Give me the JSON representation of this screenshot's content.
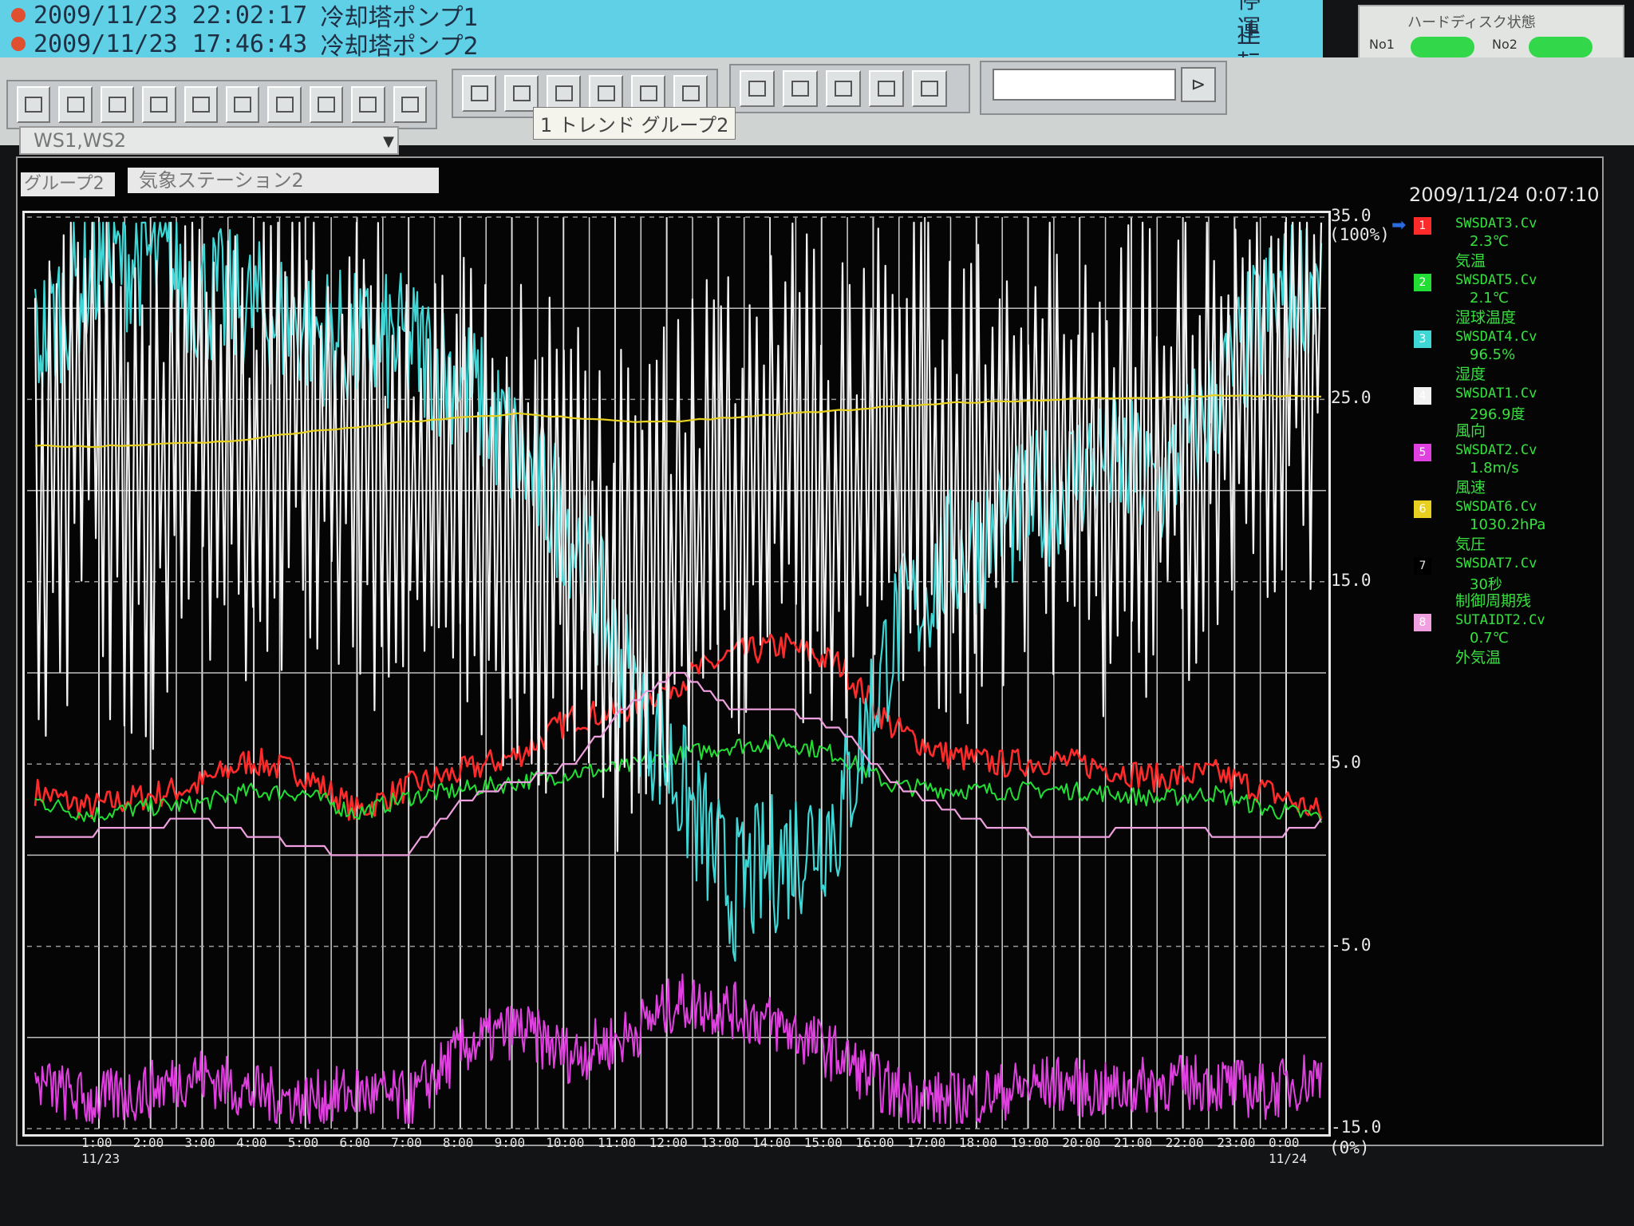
{
  "alarms": [
    {
      "time": "2009/11/23 22:02:17",
      "name": "冷却塔ポンプ1",
      "state": "停止"
    },
    {
      "time": "2009/11/23 17:46:43",
      "name": "冷却塔ポンプ2",
      "state": "運転"
    }
  ],
  "hdd": {
    "title": "ハードディスク状態",
    "no1": "No1",
    "no2": "No2"
  },
  "toolbar": {
    "tooltip": "1 トレンド グループ2",
    "ws_select": "WS1,WS2"
  },
  "group": {
    "label": "グループ2",
    "name": "気象ステーション2"
  },
  "timestamp": "2009/11/24 0:07:10",
  "legend": [
    {
      "no": "1",
      "tag": "SWSDAT3.Cv",
      "value": "2.3℃",
      "name": "気温",
      "color": "#ff2a2a"
    },
    {
      "no": "2",
      "tag": "SWSDAT5.Cv",
      "value": "2.1℃",
      "name": "湿球温度",
      "color": "#22dd33"
    },
    {
      "no": "3",
      "tag": "SWSDAT4.Cv",
      "value": "96.5%",
      "name": "湿度",
      "color": "#3fd6d6"
    },
    {
      "no": "4",
      "tag": "SWSDAT1.Cv",
      "value": "296.9度",
      "name": "風向",
      "color": "#f2f2f2"
    },
    {
      "no": "5",
      "tag": "SWSDAT2.Cv",
      "value": "1.8m/s",
      "name": "風速",
      "color": "#e040e0"
    },
    {
      "no": "6",
      "tag": "SWSDAT6.Cv",
      "value": "1030.2hPa",
      "name": "気圧",
      "color": "#e8d020"
    },
    {
      "no": "7",
      "tag": "SWSDAT7.Cv",
      "value": "30秒",
      "name": "制御周期残",
      "color": "#000000"
    },
    {
      "no": "8",
      "tag": "SUTAIDT2.Cv",
      "value": "0.7℃",
      "name": "外気温",
      "color": "#f0a0e0"
    }
  ],
  "chart_data": {
    "type": "line",
    "x": [
      "1:00",
      "2:00",
      "3:00",
      "4:00",
      "5:00",
      "6:00",
      "7:00",
      "8:00",
      "9:00",
      "10:00",
      "11:00",
      "12:00",
      "13:00",
      "14:00",
      "15:00",
      "16:00",
      "17:00",
      "18:00",
      "19:00",
      "20:00",
      "21:00",
      "22:00",
      "23:00",
      "0:00"
    ],
    "x_date_start": "11/23",
    "x_date_end": "11/24",
    "y_ticks": [
      "35.0",
      "25.0",
      "15.0",
      "5.0",
      "-5.0",
      "-15.0"
    ],
    "y_top_pct": "(100%)",
    "y_bottom_pct": "(0%)",
    "ylim": [
      -15,
      35
    ],
    "series": [
      {
        "name": "気温",
        "color": "#ff2a2a",
        "values": [
          3.5,
          2.6,
          3.2,
          3.8,
          5.2,
          4.5,
          2.4,
          3.8,
          4.6,
          5.5,
          7.5,
          8.0,
          9.5,
          11.0,
          11.5,
          10.5,
          7.0,
          5.5,
          5.0,
          5.2,
          4.8,
          4.2,
          4.5,
          3.5,
          2.3
        ]
      },
      {
        "name": "湿球温度",
        "color": "#22dd33",
        "values": [
          3.0,
          2.2,
          2.6,
          2.8,
          3.5,
          3.4,
          2.3,
          3.2,
          3.6,
          4.0,
          4.5,
          4.8,
          5.5,
          6.0,
          6.2,
          5.5,
          3.8,
          3.6,
          3.5,
          3.6,
          3.4,
          3.1,
          3.4,
          2.5,
          2.1
        ]
      },
      {
        "name": "湿度",
        "color": "#3fd6d6",
        "values": [
          28.0,
          32.0,
          33.0,
          31.0,
          30.0,
          29.0,
          28.0,
          28.0,
          26.0,
          22.0,
          18.0,
          10.0,
          4.0,
          -2.0,
          0.0,
          2.0,
          12.0,
          16.0,
          18.0,
          20.0,
          22.0,
          20.0,
          25.0,
          30.0,
          32.0
        ]
      },
      {
        "name": "風向",
        "color": "#f2f2f2",
        "values": [
          20.0,
          24.0,
          18.0,
          26.0,
          21.0,
          25.0,
          22.0,
          19.0,
          20.0,
          18.0,
          17.0,
          14.0,
          16.0,
          20.0,
          22.0,
          19.0,
          23.0,
          21.0,
          22.0,
          24.0,
          21.0,
          22.0,
          25.0,
          27.0,
          29.0
        ]
      },
      {
        "name": "風速",
        "color": "#e040e0",
        "values": [
          -12.5,
          -13.5,
          -13.0,
          -12.0,
          -13.0,
          -13.5,
          -13.0,
          -13.5,
          -10.5,
          -9.5,
          -11.0,
          -10.0,
          -8.0,
          -8.5,
          -9.5,
          -11.0,
          -13.0,
          -13.5,
          -13.0,
          -12.5,
          -13.0,
          -12.5,
          -12.5,
          -13.0,
          -12.0
        ]
      },
      {
        "name": "気圧",
        "color": "#e8d020",
        "values": [
          22.5,
          22.4,
          22.5,
          22.6,
          22.8,
          23.2,
          23.5,
          23.8,
          24.0,
          24.2,
          24.0,
          23.8,
          23.8,
          24.0,
          24.2,
          24.4,
          24.6,
          24.8,
          24.9,
          25.0,
          25.1,
          25.1,
          25.2,
          25.2,
          25.2
        ]
      },
      {
        "name": "外気温",
        "color": "#f0a0e0",
        "values": [
          1.0,
          1.2,
          1.5,
          2.0,
          1.2,
          0.5,
          0.0,
          0.2,
          3.0,
          4.0,
          5.0,
          8.0,
          10.0,
          8.0,
          8.0,
          7.0,
          4.0,
          2.5,
          1.5,
          1.0,
          1.2,
          1.6,
          1.2,
          1.0,
          1.8
        ]
      }
    ],
    "grid": true,
    "legend_position": "right"
  }
}
